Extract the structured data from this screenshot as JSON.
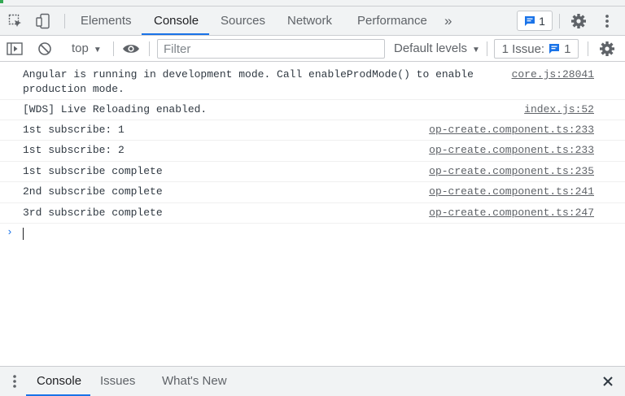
{
  "tabs": {
    "items": [
      {
        "label": "Elements"
      },
      {
        "label": "Console"
      },
      {
        "label": "Sources"
      },
      {
        "label": "Network"
      },
      {
        "label": "Performance"
      }
    ],
    "more_label": "»",
    "issue_count": "1"
  },
  "toolbar": {
    "context_label": "top",
    "filter_placeholder": "Filter",
    "levels_label": "Default levels",
    "issues_label": "1 Issue:",
    "issues_count": "1"
  },
  "messages": [
    {
      "text": "Angular is running in development mode. Call enableProdMode() to enable\nproduction mode.",
      "source": "core.js:28041"
    },
    {
      "text": "[WDS] Live Reloading enabled.",
      "source": "index.js:52"
    },
    {
      "text": "1st subscribe: 1",
      "source": "op-create.component.ts:233"
    },
    {
      "text": "1st subscribe: 2",
      "source": "op-create.component.ts:233"
    },
    {
      "text": "1st subscribe complete",
      "source": "op-create.component.ts:235"
    },
    {
      "text": "2nd subscribe complete",
      "source": "op-create.component.ts:241"
    },
    {
      "text": "3rd subscribe complete",
      "source": "op-create.component.ts:247"
    }
  ],
  "prompt_symbol": "›",
  "drawer": {
    "tabs": [
      {
        "label": "Console"
      },
      {
        "label": "Issues"
      },
      {
        "label": "What's New"
      }
    ]
  },
  "colors": {
    "accent": "#1a73e8",
    "toolbar_bg": "#f1f3f4",
    "text": "#303942"
  }
}
